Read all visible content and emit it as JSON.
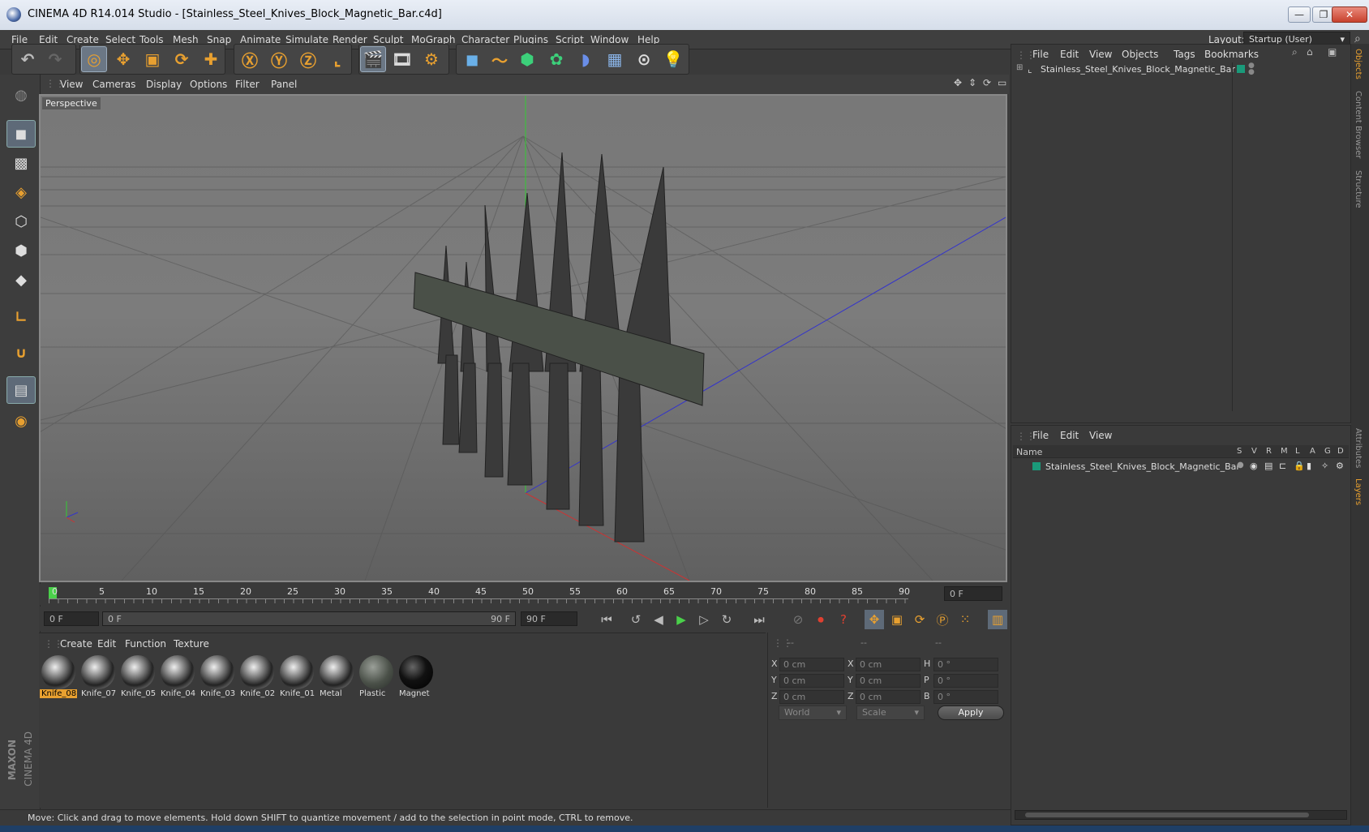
{
  "window": {
    "title": "CINEMA 4D R14.014 Studio - [Stainless_Steel_Knives_Block_Magnetic_Bar.c4d]",
    "minimize": "—",
    "maximize": "❐",
    "close": "✕"
  },
  "menubar": {
    "items": [
      "File",
      "Edit",
      "Create",
      "Select",
      "Tools",
      "Mesh",
      "Snap",
      "Animate",
      "Simulate",
      "Render",
      "Sculpt",
      "MoGraph",
      "Character",
      "Plugins",
      "Script",
      "Window",
      "Help"
    ],
    "layout_label": "Layout:",
    "layout_value": "Startup (User)"
  },
  "viewport": {
    "menu": [
      "View",
      "Cameras",
      "Display",
      "Options",
      "Filter",
      "Panel"
    ],
    "label": "Perspective"
  },
  "timeline": {
    "ticks": [
      "0",
      "5",
      "10",
      "15",
      "20",
      "25",
      "30",
      "35",
      "40",
      "45",
      "50",
      "55",
      "60",
      "65",
      "70",
      "75",
      "80",
      "85",
      "90"
    ],
    "current_frame": "0 F"
  },
  "transport": {
    "start": "0 F",
    "range_start": "0 F",
    "range_end": "90 F",
    "end": "90 F"
  },
  "materials": {
    "menu": [
      "Create",
      "Edit",
      "Function",
      "Texture"
    ],
    "items": [
      "Knife_08",
      "Knife_07",
      "Knife_05",
      "Knife_04",
      "Knife_03",
      "Knife_02",
      "Knife_01",
      "Metal",
      "Plastic",
      "Magnet"
    ],
    "selected": "Knife_08"
  },
  "coords": {
    "headers": [
      "--",
      "--",
      "--"
    ],
    "rows": [
      {
        "a": "X",
        "av": "0 cm",
        "b": "X",
        "bv": "0 cm",
        "c": "H",
        "cv": "0 °"
      },
      {
        "a": "Y",
        "av": "0 cm",
        "b": "Y",
        "bv": "0 cm",
        "c": "P",
        "cv": "0 °"
      },
      {
        "a": "Z",
        "av": "0 cm",
        "b": "Z",
        "bv": "0 cm",
        "c": "B",
        "cv": "0 °"
      }
    ],
    "mode": "World",
    "scale": "Scale",
    "apply": "Apply"
  },
  "status": "Move: Click and drag to move elements. Hold down SHIFT to quantize movement / add to the selection in point mode, CTRL to remove.",
  "objects": {
    "menu": [
      "File",
      "Edit",
      "View",
      "Objects",
      "Tags",
      "Bookmarks"
    ],
    "item": "Stainless_Steel_Knives_Block_Magnetic_Bar"
  },
  "layers": {
    "menu": [
      "File",
      "Edit",
      "View"
    ],
    "name_header": "Name",
    "cols": [
      "S",
      "V",
      "R",
      "M",
      "L",
      "A",
      "G",
      "D"
    ],
    "item": "Stainless_Steel_Knives_Block_Magnetic_Bar"
  },
  "right_tabs": [
    "Objects",
    "Content Browser",
    "Structure",
    "Attributes",
    "Layers"
  ],
  "brand": {
    "line1": "MAXON",
    "line2": "CINEMA 4D"
  },
  "colors": {
    "accent": "#e8a030",
    "layer_color": "#1a9a7a"
  }
}
